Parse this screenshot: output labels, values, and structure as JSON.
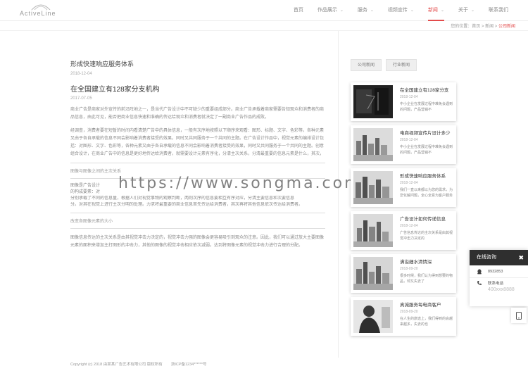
{
  "header": {
    "logo_text": "ActiveLine",
    "nav": [
      {
        "label": "首页",
        "caret": false,
        "active": false
      },
      {
        "label": "作品展示",
        "caret": true,
        "active": false
      },
      {
        "label": "服务",
        "caret": true,
        "active": false
      },
      {
        "label": "视频宣传",
        "caret": true,
        "active": false
      },
      {
        "label": "新闻",
        "caret": true,
        "active": true
      },
      {
        "label": "关于",
        "caret": true,
        "active": false
      },
      {
        "label": "联系我们",
        "caret": false,
        "active": false
      }
    ],
    "accent_color": "#e34b4b"
  },
  "breadcrumb": {
    "prefix": "您的位置：",
    "home": "首页",
    "sep1": " > ",
    "section": "新闻",
    "sep2": " > ",
    "current": "公司新闻"
  },
  "post": {
    "title": "形成快速响应服务体系",
    "date": "2018-12-04"
  },
  "article": {
    "title": "在全国建立有128家分支机构",
    "date": "2017-07-05",
    "para1": "商业广告是商家对外宣传的前沿阵地之一，是当代广告设计中不可缺少的重要组成部分。商业广告承载着商家需要告知观众和消费者的商品信息，由此可见，能否把商业信息快速和准确的传达给观众和消费者就决定了一副商业广告作品的成败。",
    "para2": "经调查，消费者要在短暂的时间内看清楚广告中的具体信息，一般有次序地按照以下顺序来观看：图形、标题、文字、色彩等。各种元素又由于各自承载的信息不同会影响着消费者接受的效果，同时又共同服务于一个共同的主题。在广告设计作品中，视觉元素的编排设计包括：对图形、文字、色彩等，各种元素又由于各自承载的信息不同会影响着消费者接受的效果，同时又共同服务于一个共同的主题。创意组合设计，在商业广告中的信息是更好地传达给消费者，就需要设计元素有序化，分清主次关系，分清最重要的信息元素是什么，其次，再次什么。商业广告是大家都能感觉到的不能被视为不占主导地位的时间和地点，而要能快速吸引消费者的注意力并获得关注，这就需要一个创意的信息传达方式。",
    "sub1": "图像与图像之间的主次关系",
    "intro": [
      "图像是广告设计",
      "的构成要素：对",
      "分别承载了不同的信息量，根据人们对视觉事物的观察判断，两则次序的信息要相互有序对应，分清主要信息和次要信息",
      "分。对其在视觉上进行主次分明的处理。力求将最重要的商业信息首先传达给消费者，其次再将其他信息依次传达给消费者。"
    ],
    "sub2": "改变各图像元素的大小",
    "para3": "图像信息传达的主次关系是由其视觉冲击力决定的，视觉冲击力强的图像会更容易吸引到观众的注意。因此，我们可以通过放大主要图像元素的面积来增加主打图形的冲击力，其他的图像的视觉冲击相应依次减弱。达到将图像元素的视觉冲击力进行合理的分配。"
  },
  "watermark": "https://www.songma.com",
  "sidebar": {
    "tabs": [
      "公司新闻",
      "行业新闻"
    ],
    "news": [
      {
        "title": "在全国建立有128家分支",
        "date": "2018-12-04",
        "desc": "中小企业在发展过程中难免会遇到的问题，产品营销不",
        "thumb": "dark"
      },
      {
        "title": "电商视频宣传片设计多少",
        "date": "2018-12-04",
        "desc": "中小企业在发展过程中难免会遇到的问题，产品营销不",
        "thumb": "city"
      },
      {
        "title": "形成快速响应服务体系",
        "date": "2018-12-04",
        "desc": "我们一直以来都以为您的需求，为您化解问题，全心全意为客户服务",
        "thumb": "city"
      },
      {
        "title": "广告设计如何传递信息",
        "date": "2018-12-04",
        "desc": "广告信息传达的主次关系是由其视觉冲击力决定的",
        "thumb": "city"
      },
      {
        "title": "满溢细水清情深",
        "date": "2018-09-20",
        "desc": "很多时候，我们认为得到想要的物品，却又失去了",
        "thumb": "city"
      },
      {
        "title": "真诚服务每电商客户",
        "date": "2018-09-20",
        "desc": "在人生的旅途上，我们得到的会越来越多，失去的也",
        "thumb": "man"
      }
    ]
  },
  "footer": {
    "copyright": "Copyright (c) 2018 由某某广告艺术有限公司 版权所有",
    "icp": "浙ICP备1234******号"
  },
  "widget": {
    "title": "在线咨询",
    "close": "✖",
    "qq": "8932853",
    "tel_label": "联系电话",
    "tel": "400xxx8888"
  }
}
